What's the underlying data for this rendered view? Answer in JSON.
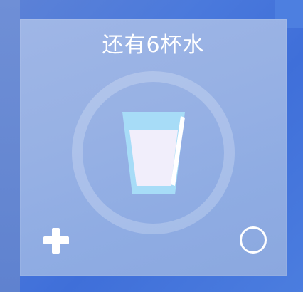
{
  "widget": {
    "title": "还有6杯水",
    "remaining_cups": 6,
    "icons": {
      "cup": "water-glass-icon",
      "add": "plus-icon",
      "reset": "circle-icon"
    },
    "colors": {
      "text": "#ffffff",
      "cup_rim": "#a7dcf7",
      "water": "#f1eefb",
      "ring": "rgba(255,255,255,0.22)"
    }
  }
}
